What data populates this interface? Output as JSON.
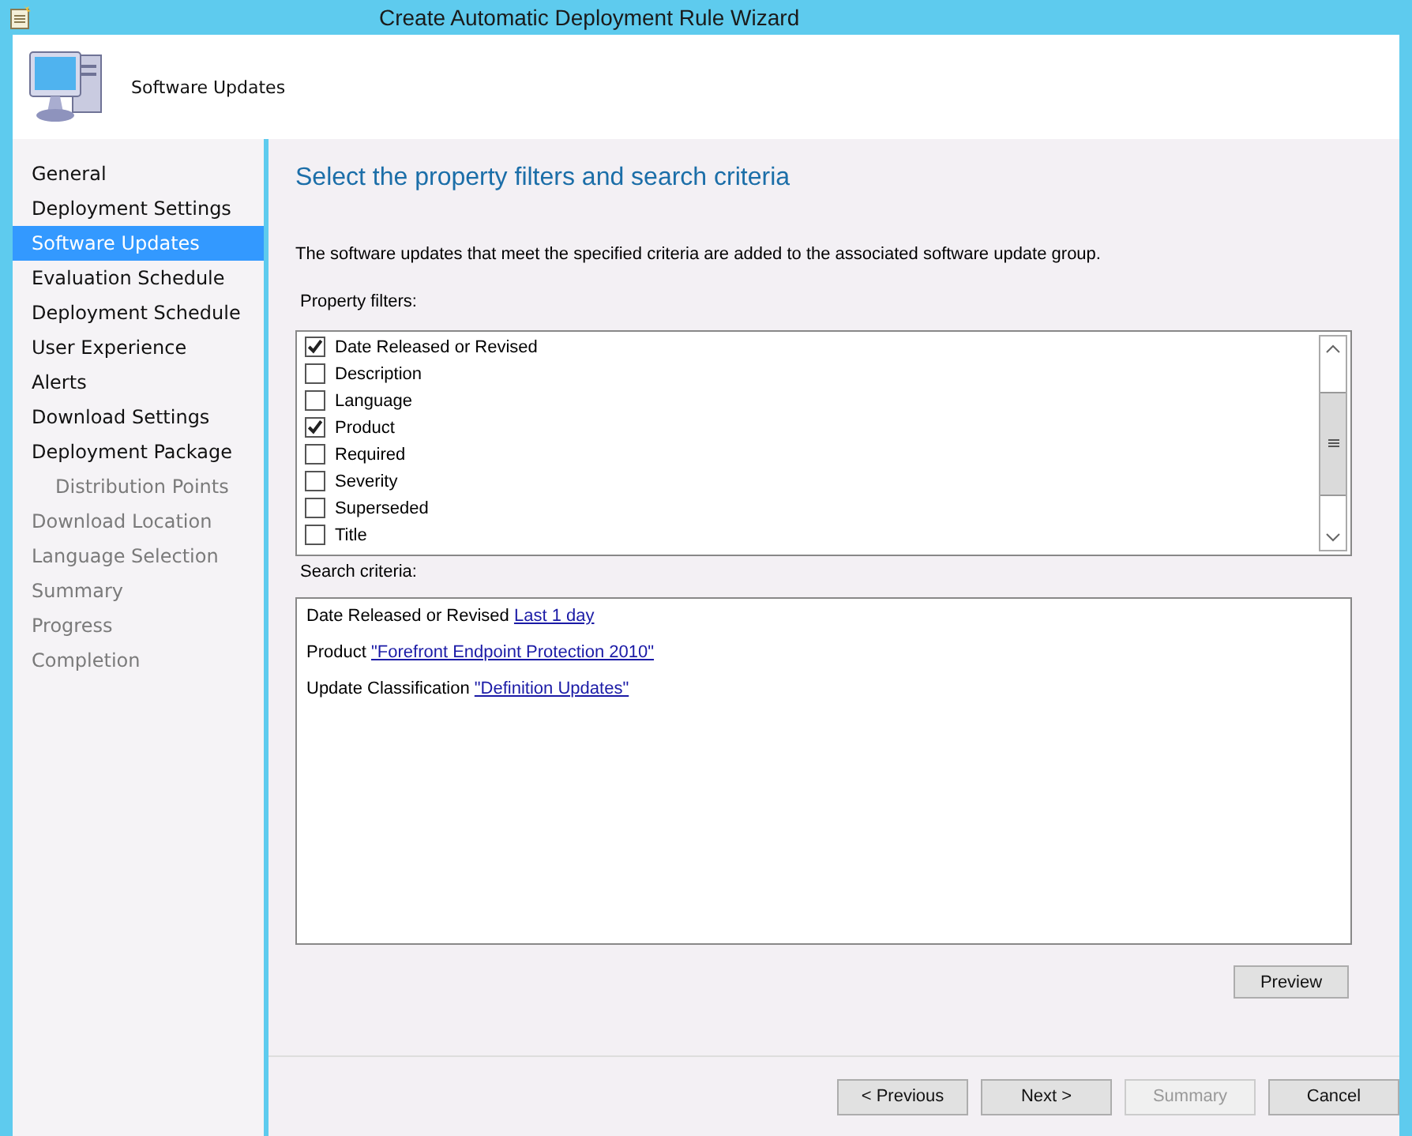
{
  "window": {
    "title": "Create Automatic Deployment Rule Wizard"
  },
  "header": {
    "title": "Software Updates"
  },
  "sidebar": {
    "items": [
      {
        "label": "General",
        "selected": false,
        "disabled": false
      },
      {
        "label": "Deployment Settings",
        "selected": false,
        "disabled": false
      },
      {
        "label": "Software Updates",
        "selected": true,
        "disabled": false
      },
      {
        "label": "Evaluation Schedule",
        "selected": false,
        "disabled": false
      },
      {
        "label": "Deployment Schedule",
        "selected": false,
        "disabled": false
      },
      {
        "label": "User Experience",
        "selected": false,
        "disabled": false
      },
      {
        "label": "Alerts",
        "selected": false,
        "disabled": false
      },
      {
        "label": "Download Settings",
        "selected": false,
        "disabled": false
      },
      {
        "label": "Deployment Package",
        "selected": false,
        "disabled": false,
        "children": [
          {
            "label": "Distribution Points",
            "selected": false,
            "disabled": true
          }
        ]
      },
      {
        "label": "Download Location",
        "selected": false,
        "disabled": true
      },
      {
        "label": "Language Selection",
        "selected": false,
        "disabled": true
      },
      {
        "label": "Summary",
        "selected": false,
        "disabled": true
      },
      {
        "label": "Progress",
        "selected": false,
        "disabled": true
      },
      {
        "label": "Completion",
        "selected": false,
        "disabled": true
      }
    ]
  },
  "page": {
    "heading": "Select the property filters and search criteria",
    "description": "The software updates that meet the specified criteria are added to the associated software update group.",
    "filters_label": "Property filters:",
    "filters": [
      {
        "label": "Date Released or Revised",
        "checked": true
      },
      {
        "label": "Description",
        "checked": false
      },
      {
        "label": "Language",
        "checked": false
      },
      {
        "label": "Product",
        "checked": true
      },
      {
        "label": "Required",
        "checked": false
      },
      {
        "label": "Severity",
        "checked": false
      },
      {
        "label": "Superseded",
        "checked": false
      },
      {
        "label": "Title",
        "checked": false
      }
    ],
    "criteria_label": "Search criteria:",
    "criteria": [
      {
        "label": "Date Released or Revised",
        "link": "Last 1 day"
      },
      {
        "label": "Product",
        "link": "\"Forefront Endpoint Protection 2010\""
      },
      {
        "label": "Update Classification",
        "link": "\"Definition Updates\""
      }
    ],
    "preview_button": "Preview"
  },
  "buttons": [
    {
      "label": "< Previous",
      "disabled": false
    },
    {
      "label": "Next >",
      "disabled": false
    },
    {
      "label": "Summary",
      "disabled": true
    },
    {
      "label": "Cancel",
      "disabled": false
    }
  ]
}
